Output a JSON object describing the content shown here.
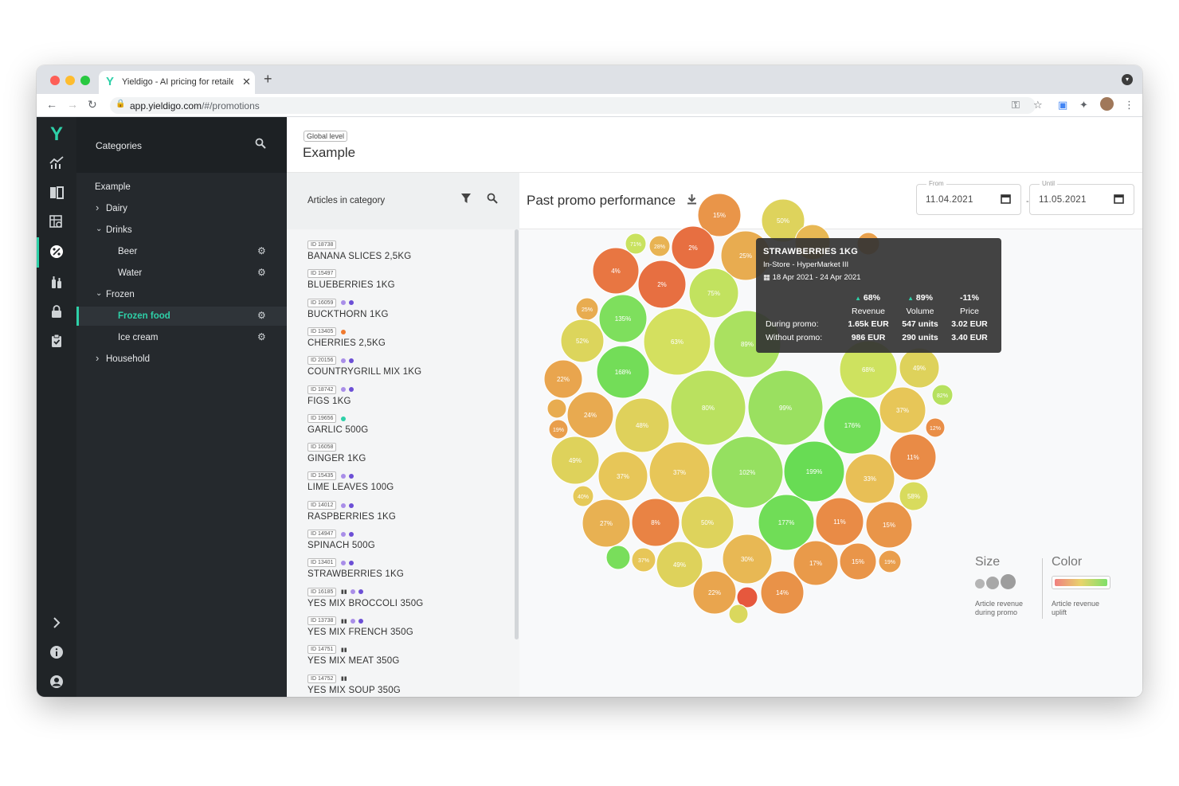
{
  "browser": {
    "tab_title": "Yieldigo - AI pricing for retailers",
    "url_host": "app.yieldigo.com",
    "url_path": "/#/promotions"
  },
  "categories": {
    "header": "Categories",
    "items": [
      {
        "label": "Example",
        "level": 0,
        "expander": "none"
      },
      {
        "label": "Dairy",
        "level": 1,
        "expander": "right"
      },
      {
        "label": "Drinks",
        "level": 1,
        "expander": "down"
      },
      {
        "label": "Beer",
        "level": 2,
        "expander": "none",
        "gear": true
      },
      {
        "label": "Water",
        "level": 2,
        "expander": "none",
        "gear": true
      },
      {
        "label": "Frozen",
        "level": 1,
        "expander": "down"
      },
      {
        "label": "Frozen food",
        "level": 2,
        "expander": "none",
        "gear": true,
        "selected": true
      },
      {
        "label": "Ice cream",
        "level": 2,
        "expander": "none",
        "gear": true
      },
      {
        "label": "Household",
        "level": 1,
        "expander": "right"
      }
    ]
  },
  "header": {
    "badge": "Global level",
    "title": "Example"
  },
  "articles": {
    "header": "Articles in category",
    "items": [
      {
        "id": "ID 18738",
        "name": "BANANA SLICES 2,5KG",
        "marks": []
      },
      {
        "id": "ID 15497",
        "name": "BLUEBERRIES 1KG",
        "marks": []
      },
      {
        "id": "ID 16059",
        "name": "BUCKTHORN 1KG",
        "marks": [
          "#a98ee8",
          "#6c4fd6"
        ]
      },
      {
        "id": "ID 13405",
        "name": "CHERRIES 2,5KG",
        "marks": [
          "#f07a2f"
        ]
      },
      {
        "id": "ID 20156",
        "name": "COUNTRYGRILL MIX 1KG",
        "marks": [
          "#a98ee8",
          "#6c4fd6"
        ]
      },
      {
        "id": "ID 18742",
        "name": "FIGS 1KG",
        "marks": [
          "#a98ee8",
          "#6c4fd6"
        ]
      },
      {
        "id": "ID 19656",
        "name": "GARLIC 500G",
        "marks": [
          "#2ed0a8"
        ]
      },
      {
        "id": "ID 16058",
        "name": "GINGER 1KG",
        "marks": []
      },
      {
        "id": "ID 15435",
        "name": "LIME LEAVES 100G",
        "marks": [
          "#a98ee8",
          "#6c4fd6"
        ]
      },
      {
        "id": "ID 14012",
        "name": "RASPBERRIES 1KG",
        "marks": [
          "#a98ee8",
          "#6c4fd6"
        ]
      },
      {
        "id": "ID 14947",
        "name": "SPINACH 500G",
        "marks": [
          "#a98ee8",
          "#6c4fd6"
        ]
      },
      {
        "id": "ID 13401",
        "name": "STRAWBERRIES 1KG",
        "marks": [
          "#a98ee8",
          "#6c4fd6"
        ]
      },
      {
        "id": "ID 16185",
        "name": "YES MIX BROCCOLI 350G",
        "marks": [
          "bottles",
          "#a98ee8",
          "#6c4fd6"
        ]
      },
      {
        "id": "ID 13738",
        "name": "YES MIX FRENCH 350G",
        "marks": [
          "bottles",
          "#a98ee8",
          "#6c4fd6"
        ]
      },
      {
        "id": "ID 14751",
        "name": "YES MIX MEAT 350G",
        "marks": [
          "bottles"
        ]
      },
      {
        "id": "ID 14752",
        "name": "YES MIX SOUP 350G",
        "marks": [
          "bottles"
        ]
      }
    ]
  },
  "performance": {
    "title": "Past promo performance",
    "from_label": "From",
    "from_value": "11.04.2021",
    "until_label": "Until",
    "until_value": "11.05.2021",
    "separator": "-"
  },
  "tooltip": {
    "name": "STRAWBERRIES 1KG",
    "store": "In-Store - HyperMarket III",
    "dates": "18 Apr 2021 - 24 Apr 2021",
    "revenue_pct": "68%",
    "volume_pct": "89%",
    "price_pct": "-11%",
    "revenue_label": "Revenue",
    "volume_label": "Volume",
    "price_label": "Price",
    "during_label": "During promo:",
    "without_label": "Without promo:",
    "during": [
      "1.65k EUR",
      "547 units",
      "3.02 EUR"
    ],
    "without": [
      "986 EUR",
      "290 units",
      "3.40 EUR"
    ]
  },
  "legend": {
    "size_title": "Size",
    "size_sub": [
      "Article revenue",
      "during promo"
    ],
    "color_title": "Color",
    "color_sub": [
      "Article revenue",
      "uplift"
    ]
  },
  "chart_data": {
    "type": "bubble",
    "size_measure": "Article revenue during promo",
    "color_measure": "Article revenue uplift",
    "bubbles": [
      {
        "label": "15%",
        "uplift": 15,
        "size": 27
      },
      {
        "label": "50%",
        "uplift": 50,
        "size": 27
      },
      {
        "label": "",
        "uplift": 30,
        "size": 22
      },
      {
        "label": "",
        "uplift": 20,
        "size": 14
      },
      {
        "label": "71%",
        "uplift": 71,
        "size": 13
      },
      {
        "label": "28%",
        "uplift": 28,
        "size": 13
      },
      {
        "label": "2%",
        "uplift": 2,
        "size": 27
      },
      {
        "label": "25%",
        "uplift": 25,
        "size": 31
      },
      {
        "label": "4%",
        "uplift": 4,
        "size": 29
      },
      {
        "label": "2%",
        "uplift": 2,
        "size": 30
      },
      {
        "label": "75%",
        "uplift": 75,
        "size": 31
      },
      {
        "label": "25%",
        "uplift": 25,
        "size": 14
      },
      {
        "label": "135%",
        "uplift": 135,
        "size": 30
      },
      {
        "label": "63%",
        "uplift": 63,
        "size": 42
      },
      {
        "label": "89%",
        "uplift": 89,
        "size": 42
      },
      {
        "label": "52%",
        "uplift": 52,
        "size": 27
      },
      {
        "label": "168%",
        "uplift": 168,
        "size": 33
      },
      {
        "label": "22%",
        "uplift": 22,
        "size": 24
      },
      {
        "label": "24%",
        "uplift": 24,
        "size": 29
      },
      {
        "label": "48%",
        "uplift": 48,
        "size": 34
      },
      {
        "label": "80%",
        "uplift": 80,
        "size": 47
      },
      {
        "label": "99%",
        "uplift": 99,
        "size": 47
      },
      {
        "label": "68%",
        "uplift": 68,
        "size": 36
      },
      {
        "label": "49%",
        "uplift": 49,
        "size": 25
      },
      {
        "label": "82%",
        "uplift": 82,
        "size": 13
      },
      {
        "label": "176%",
        "uplift": 176,
        "size": 36
      },
      {
        "label": "37%",
        "uplift": 37,
        "size": 29
      },
      {
        "label": "12%",
        "uplift": 12,
        "size": 12
      },
      {
        "label": "",
        "uplift": 25,
        "size": 12
      },
      {
        "label": "19%",
        "uplift": 19,
        "size": 12
      },
      {
        "label": "49%",
        "uplift": 49,
        "size": 30
      },
      {
        "label": "37%",
        "uplift": 37,
        "size": 31
      },
      {
        "label": "37%",
        "uplift": 37,
        "size": 38
      },
      {
        "label": "102%",
        "uplift": 102,
        "size": 45
      },
      {
        "label": "199%",
        "uplift": 199,
        "size": 38
      },
      {
        "label": "33%",
        "uplift": 33,
        "size": 31
      },
      {
        "label": "11%",
        "uplift": 11,
        "size": 29
      },
      {
        "label": "40%",
        "uplift": 40,
        "size": 13
      },
      {
        "label": "58%",
        "uplift": 58,
        "size": 18
      },
      {
        "label": "27%",
        "uplift": 27,
        "size": 30
      },
      {
        "label": "8%",
        "uplift": 8,
        "size": 30
      },
      {
        "label": "50%",
        "uplift": 50,
        "size": 33
      },
      {
        "label": "177%",
        "uplift": 177,
        "size": 35
      },
      {
        "label": "11%",
        "uplift": 11,
        "size": 30
      },
      {
        "label": "15%",
        "uplift": 15,
        "size": 29
      },
      {
        "label": "",
        "uplift": 150,
        "size": 15
      },
      {
        "label": "37%",
        "uplift": 37,
        "size": 15
      },
      {
        "label": "49%",
        "uplift": 49,
        "size": 29
      },
      {
        "label": "30%",
        "uplift": 30,
        "size": 31
      },
      {
        "label": "17%",
        "uplift": 17,
        "size": 28
      },
      {
        "label": "15%",
        "uplift": 15,
        "size": 23
      },
      {
        "label": "19%",
        "uplift": 19,
        "size": 14
      },
      {
        "label": "22%",
        "uplift": 22,
        "size": 27
      },
      {
        "label": "",
        "uplift": -5,
        "size": 13
      },
      {
        "label": "14%",
        "uplift": 14,
        "size": 27
      },
      {
        "label": "",
        "uplift": 55,
        "size": 12
      }
    ]
  }
}
